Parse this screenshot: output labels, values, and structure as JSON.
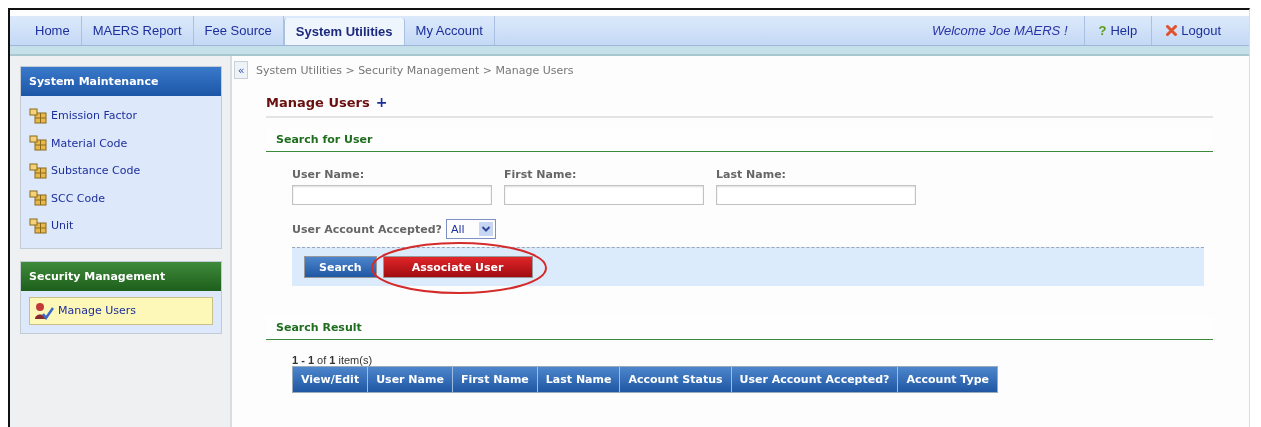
{
  "tabs": [
    {
      "label": "Home",
      "selected": false
    },
    {
      "label": "MAERS Report",
      "selected": false
    },
    {
      "label": "Fee Source",
      "selected": false
    },
    {
      "label": "System Utilities",
      "selected": true
    },
    {
      "label": "My Account",
      "selected": false
    }
  ],
  "welcome": "Welcome Joe MAERS !",
  "top_links": [
    {
      "label": "Help",
      "kind": "help",
      "icon": "?"
    },
    {
      "label": "Logout",
      "kind": "logout"
    }
  ],
  "sidebar": [
    {
      "title": "System Maintenance",
      "kind": "blue",
      "items": [
        {
          "label": "Emission Factor",
          "selected": false,
          "kind": "grid"
        },
        {
          "label": "Material Code",
          "selected": false,
          "kind": "grid"
        },
        {
          "label": "Substance Code",
          "selected": false,
          "kind": "grid"
        },
        {
          "label": "SCC Code",
          "selected": false,
          "kind": "grid"
        },
        {
          "label": "Unit",
          "selected": false,
          "kind": "grid"
        }
      ]
    },
    {
      "title": "Security Management",
      "kind": "green",
      "items": [
        {
          "label": "Manage Users",
          "selected": true,
          "kind": "users"
        }
      ]
    }
  ],
  "collapse_button": "«",
  "breadcrumb": "System Utilities > Security Management > Manage Users",
  "page_title": "Manage Users",
  "page_title_add": "+",
  "search_section": {
    "title": "Search for User",
    "fields": [
      {
        "label": "User Name:"
      },
      {
        "label": "First Name:"
      },
      {
        "label": "Last Name:"
      }
    ],
    "accepted_label": "User Account Accepted?",
    "accepted_value": "All",
    "buttons": [
      {
        "label": "Search",
        "kind": "blue",
        "highlighted": false
      },
      {
        "label": "Associate User",
        "kind": "red",
        "highlighted": true
      }
    ]
  },
  "result_section": {
    "title": "Search Result",
    "pager": "**1 - 1** of **1** item(s)",
    "columns": [
      "View/Edit",
      "User Name",
      "First Name",
      "Last Name",
      "Account Status",
      "User Account Accepted?",
      "Account Type"
    ]
  }
}
